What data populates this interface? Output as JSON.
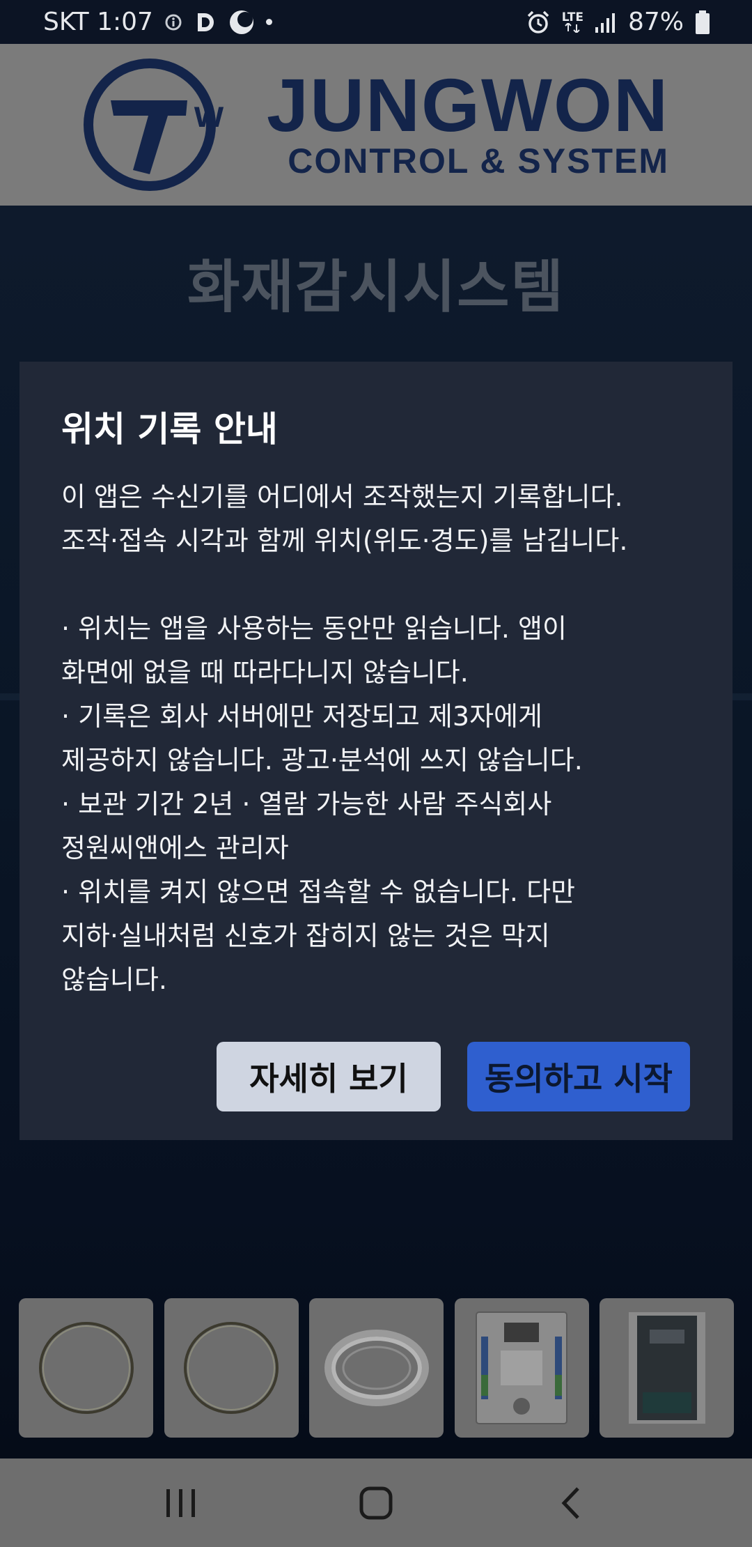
{
  "status_bar": {
    "carrier_time": "SKT 1:07",
    "network": "LTE",
    "battery": "87%",
    "icons": [
      "info-icon",
      "d-app-icon",
      "moon-icon",
      "notification-dot-icon",
      "alarm-icon",
      "lte-icon",
      "signal-icon",
      "battery-icon"
    ]
  },
  "header": {
    "logo_name": "JUNGWON",
    "logo_sub": "CONTROL & SYSTEM"
  },
  "app": {
    "title": "화재감시시스템"
  },
  "modal": {
    "title": "위치 기록 안내",
    "intro": "이 앱은 수신기를 어디에서 조작했는지 기록합니다.\n조작·접속 시각과 함께 위치(위도·경도)를 남깁니다.",
    "bullets": [
      "· 위치는 앱을 사용하는 동안만 읽습니다. 앱이\n화면에 없을 때 따라다니지 않습니다.",
      "· 기록은 회사 서버에만 저장되고 제3자에게\n제공하지 않습니다. 광고·분석에 쓰지 않습니다.",
      "· 보관 기간 2년 · 열람 가능한 사람 주식회사\n정원씨앤에스 관리자",
      "· 위치를 켜지 않으면 접속할 수 없습니다. 다만\n지하·실내처럼 신호가 잡히지 않는 것은 막지\n않습니다."
    ],
    "details_label": "자세히 보기",
    "agree_label": "동의하고 시작"
  },
  "products": [
    {
      "name": "ring-sensor-image"
    },
    {
      "name": "ring-sensor-image"
    },
    {
      "name": "cable-coil-image"
    },
    {
      "name": "receiver-board-image"
    },
    {
      "name": "control-panel-image"
    }
  ],
  "nav": {
    "icons": [
      "recent-apps-icon",
      "home-icon",
      "back-icon"
    ]
  },
  "colors": {
    "modal_bg": "#212837",
    "agree_button": "#2f5fcf",
    "details_button": "#cfd5e1",
    "logo_navy": "#13244a"
  }
}
